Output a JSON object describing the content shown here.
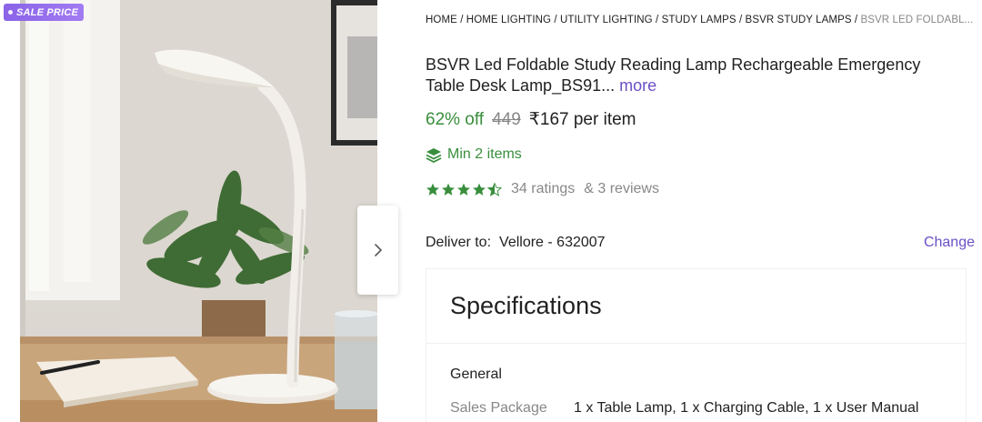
{
  "badge": {
    "label": "SALE PRICE"
  },
  "breadcrumb": {
    "items": [
      "HOME /",
      "HOME LIGHTING /",
      "UTILITY LIGHTING /",
      "STUDY LAMPS /",
      "BSVR STUDY LAMPS /"
    ],
    "current": "BSVR LED FOLDABL..."
  },
  "product": {
    "title": "BSVR Led Foldable Study Reading Lamp Rechargeable Emergency Table Desk Lamp_BS91...",
    "more_label": "more",
    "discount": "62% off",
    "mrp": "449",
    "price": "₹167 per item",
    "min_items": "Min 2 items",
    "rating_value": 4.5,
    "ratings_text": "34 ratings",
    "reviews_text": "& 3 reviews"
  },
  "delivery": {
    "label": "Deliver to:",
    "location": "Vellore - 632007",
    "change_label": "Change"
  },
  "specifications": {
    "heading": "Specifications",
    "group": "General",
    "rows": [
      {
        "key": "Sales Package",
        "value": "1 x Table Lamp, 1 x Charging Cable, 1 x User Manual"
      }
    ]
  },
  "colors": {
    "accent": "#6b4fc6",
    "green": "#388e3c",
    "badge": "#8a63e8",
    "muted": "#878787"
  },
  "icons": [
    "chevron-right-icon",
    "stack-icon",
    "star-icon",
    "half-star-icon"
  ]
}
